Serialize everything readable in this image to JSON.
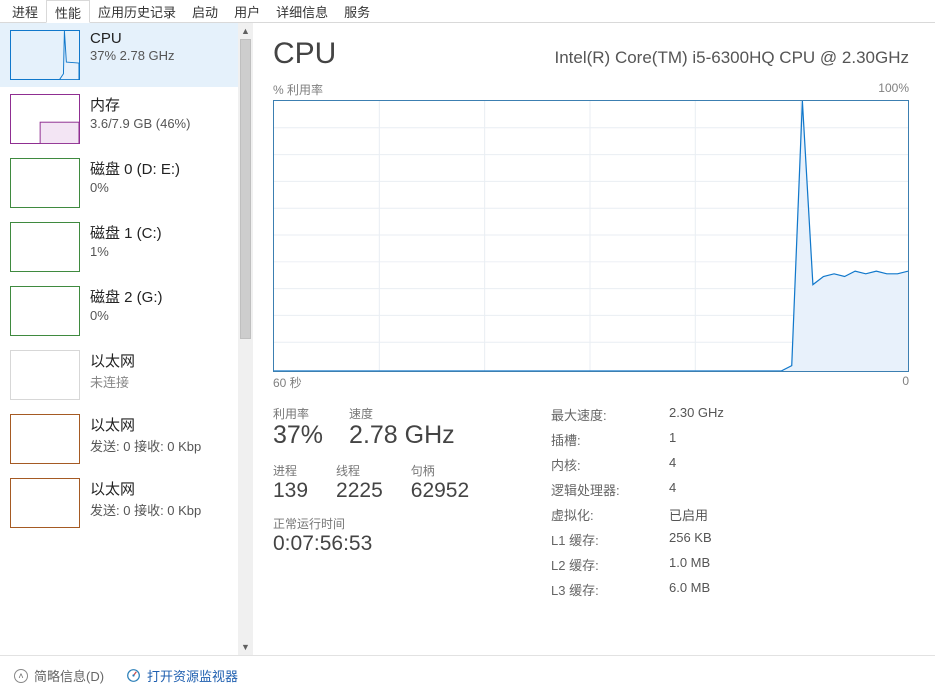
{
  "tabs": [
    "进程",
    "性能",
    "应用历史记录",
    "启动",
    "用户",
    "详细信息",
    "服务"
  ],
  "active_tab_index": 1,
  "sidebar": {
    "items": [
      {
        "title": "CPU",
        "sub": "37% 2.78 GHz"
      },
      {
        "title": "内存",
        "sub": "3.6/7.9 GB (46%)"
      },
      {
        "title": "磁盘 0 (D: E:)",
        "sub": "0%"
      },
      {
        "title": "磁盘 1 (C:)",
        "sub": "1%"
      },
      {
        "title": "磁盘 2 (G:)",
        "sub": "0%"
      },
      {
        "title": "以太网",
        "sub": "未连接"
      },
      {
        "title": "以太网",
        "sub": "发送: 0 接收: 0 Kbp"
      },
      {
        "title": "以太网",
        "sub": "发送: 0 接收: 0 Kbp"
      }
    ],
    "selected": 0
  },
  "detail": {
    "title": "CPU",
    "subtitle": "Intel(R) Core(TM) i5-6300HQ CPU @ 2.30GHz",
    "chart_y_label": "% 利用率",
    "chart_y_max": "100%",
    "chart_x_left": "60 秒",
    "chart_x_right": "0",
    "metrics": {
      "util_label": "利用率",
      "util": "37%",
      "speed_label": "速度",
      "speed": "2.78 GHz",
      "proc_label": "进程",
      "proc": "139",
      "threads_label": "线程",
      "threads": "2225",
      "handles_label": "句柄",
      "handles": "62952",
      "uptime_label": "正常运行时间",
      "uptime": "0:07:56:53"
    },
    "specs": [
      {
        "k": "最大速度:",
        "v": "2.30 GHz"
      },
      {
        "k": "插槽:",
        "v": "1"
      },
      {
        "k": "内核:",
        "v": "4"
      },
      {
        "k": "逻辑处理器:",
        "v": "4"
      },
      {
        "k": "虚拟化:",
        "v": "已启用"
      },
      {
        "k": "L1 缓存:",
        "v": "256 KB"
      },
      {
        "k": "L2 缓存:",
        "v": "1.0 MB"
      },
      {
        "k": "L3 缓存:",
        "v": "6.0 MB"
      }
    ]
  },
  "footer": {
    "brief": "简略信息(D)",
    "monitor": "打开资源监视器"
  },
  "chart_data": {
    "type": "line",
    "title": "CPU % 利用率",
    "xlabel": "秒 (60→0)",
    "ylabel": "% 利用率",
    "ylim": [
      0,
      100
    ],
    "xlim": [
      60,
      0
    ],
    "x": [
      60,
      55,
      50,
      45,
      40,
      35,
      30,
      25,
      20,
      15,
      12,
      11,
      10,
      9,
      8,
      7,
      6,
      5,
      4,
      3,
      2,
      1,
      0
    ],
    "values": [
      0,
      0,
      0,
      0,
      0,
      0,
      0,
      0,
      0,
      0,
      0,
      2,
      100,
      32,
      35,
      36,
      35,
      37,
      36,
      37,
      36,
      36,
      37
    ]
  }
}
